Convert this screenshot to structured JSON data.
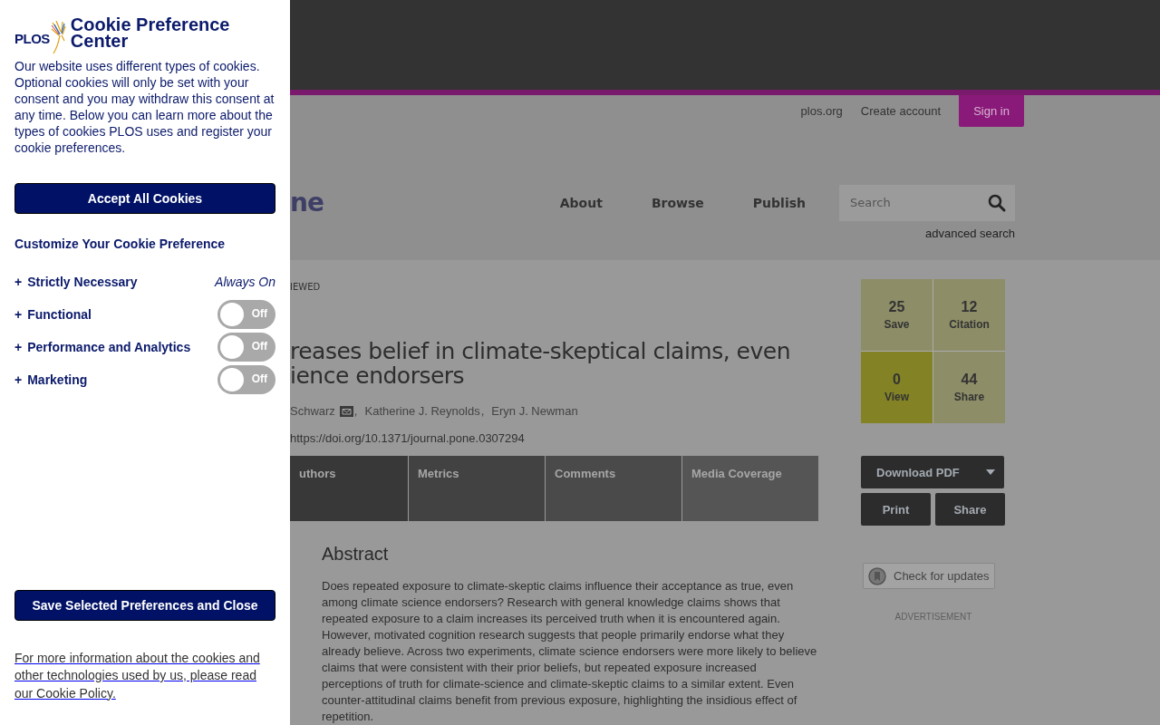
{
  "cookie_panel": {
    "logo_text": "PLOS",
    "title": "Cookie Preference Center",
    "description": "Our website uses different types of cookies. Optional cookies will only be set with your consent and you may withdraw this consent at any time. Below you can learn more about the types of cookies PLOS uses and register your cookie preferences.",
    "accept_button": "Accept All Cookies",
    "customize_heading": "Customize Your Cookie Preference",
    "categories": [
      {
        "kind": "fixed",
        "expander": "+",
        "label": "Strictly Necessary",
        "status": "Always On"
      },
      {
        "kind": "toggle",
        "expander": "+",
        "label": "Functional",
        "on": false,
        "toggle_label": "Off"
      },
      {
        "kind": "toggle",
        "expander": "+",
        "label": "Performance and Analytics",
        "on": false,
        "toggle_label": "Off"
      },
      {
        "kind": "toggle",
        "expander": "+",
        "label": "Marketing",
        "on": false,
        "toggle_label": "Off"
      }
    ],
    "save_button": "Save Selected Preferences and Close",
    "policy_link": "For more information about the cookies and other technologies used by us, please read our Cookie Policy."
  },
  "page": {
    "top_links": [
      "plos.org",
      "Create account"
    ],
    "sign_in": "Sign in",
    "logo_fragment": "ne",
    "nav": [
      "About",
      "Browse",
      "Publish"
    ],
    "search": {
      "placeholder": "Search"
    },
    "advanced_search": "advanced search",
    "badge_fragment": "IEWED",
    "title_lines": [
      "reases belief in climate-skeptical claims, even",
      "ience endorsers"
    ],
    "authors": [
      {
        "name": "Schwarz",
        "mail": true,
        "separator": ","
      },
      {
        "name": "Katherine J. Reynolds",
        "mail": false,
        "separator": ","
      },
      {
        "name": "Eryn J. Newman",
        "mail": false
      }
    ],
    "doi": "https://doi.org/10.1371/journal.pone.0307294",
    "tabs": [
      {
        "label": "uthors"
      },
      {
        "label": "Metrics"
      },
      {
        "label": "Comments"
      },
      {
        "label": "Media Coverage"
      }
    ],
    "abstract_heading": "Abstract",
    "abstract": "Does repeated exposure to climate-skeptic claims influence their acceptance as true, even among climate science endorsers? Research with general knowledge claims shows that repeated exposure to a claim increases its perceived truth when it is encountered again. However, motivated cognition research suggests that people primarily endorse what they already believe. Across two experiments, climate science endorsers were more likely to believe claims that were consistent with their prior beliefs, but repeated exposure increased perceptions of truth for climate-science and climate-skeptic claims to a similar extent. Even counter-attitudinal claims benefit from previous exposure, highlighting the insidious effect of repetition.",
    "metrics": [
      {
        "count": "25",
        "label": "Save",
        "selected": false
      },
      {
        "count": "12",
        "label": "Citation",
        "selected": false
      },
      {
        "count": "0",
        "label": "View",
        "selected": true
      },
      {
        "count": "44",
        "label": "Share",
        "selected": false
      }
    ],
    "download_button": "Download PDF",
    "print_button": "Print",
    "share_button": "Share",
    "check_updates": "Check for updates",
    "advertisement": "ADVERTISEMENT"
  }
}
